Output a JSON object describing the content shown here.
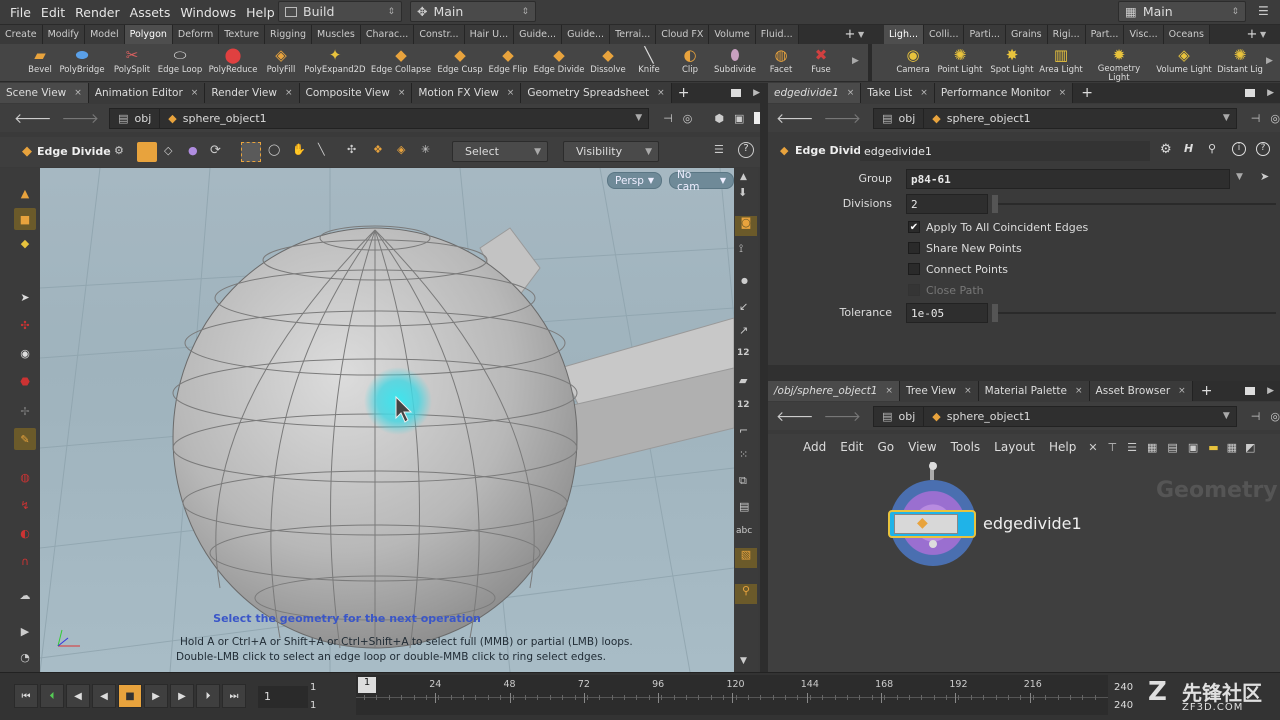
{
  "menubar": {
    "items": [
      "File",
      "Edit",
      "Render",
      "Assets",
      "Windows",
      "Help"
    ],
    "desktop_label": "Build",
    "context_label": "Main",
    "right_label": "Main"
  },
  "shelf_tabs_left": [
    "Create",
    "Modify",
    "Model",
    "Polygon",
    "Deform",
    "Texture",
    "Rigging",
    "Muscles",
    "Charac...",
    "Constr...",
    "Hair U...",
    "Guide...",
    "Guide...",
    "Terrai...",
    "Cloud FX",
    "Volume",
    "Fluid..."
  ],
  "shelf_tabs_right": [
    "Ligh...",
    "Colli...",
    "Parti...",
    "Grains",
    "Rigi...",
    "Part...",
    "Visc...",
    "Oceans"
  ],
  "shelf_tools_left": [
    "Bevel",
    "PolyBridge",
    "PolySplit",
    "Edge Loop",
    "PolyReduce",
    "PolyFill",
    "PolyExpand2D",
    "Edge Collapse",
    "Edge Cusp",
    "Edge Flip",
    "Edge Divide",
    "Dissolve",
    "Knife",
    "Clip",
    "Subdivide",
    "Facet",
    "Fuse"
  ],
  "shelf_tools_right": [
    "Camera",
    "Point Light",
    "Spot Light",
    "Area Light",
    "Geometry Light",
    "Volume Light",
    "Distant Lig"
  ],
  "left_pane": {
    "tabs": [
      "Scene View",
      "Animation Editor",
      "Render View",
      "Composite View",
      "Motion FX View",
      "Geometry Spreadsheet"
    ],
    "path": [
      "obj",
      "sphere_object1"
    ],
    "tool_name": "Edge Divide",
    "select_label": "Select",
    "visibility_label": "Visibility",
    "persp_label": "Persp",
    "cam_label": "No cam",
    "hint_title": "Select the geometry for the next operation",
    "hint_line1": "Hold A or Ctrl+A or Shift+A or Ctrl+Shift+A to select full (MMB) or partial (LMB) loops.",
    "hint_line2": "Double-LMB click to select an edge loop or double-MMB click to ring select edges.",
    "right_tool_labels": [
      "12",
      "12",
      "abc"
    ]
  },
  "params_pane": {
    "tabs": [
      "edgedivide1",
      "Take List",
      "Performance Monitor"
    ],
    "path": [
      "obj",
      "sphere_object1"
    ],
    "node_type": "Edge Divide",
    "node_name": "edgedivide1",
    "group_label": "Group",
    "group_value": "p84-61",
    "divisions_label": "Divisions",
    "divisions_value": "2",
    "checkboxes": [
      {
        "label": "Apply To All Coincident Edges",
        "checked": true
      },
      {
        "label": "Share New Points",
        "checked": false
      },
      {
        "label": "Connect Points",
        "checked": false
      },
      {
        "label": "Close Path",
        "checked": false,
        "disabled": true
      }
    ],
    "tolerance_label": "Tolerance",
    "tolerance_value": "1e-05"
  },
  "network_pane": {
    "tabs": [
      "/obj/sphere_object1",
      "Tree View",
      "Material Palette",
      "Asset Browser"
    ],
    "path": [
      "obj",
      "sphere_object1"
    ],
    "menu": [
      "Add",
      "Edit",
      "Go",
      "View",
      "Tools",
      "Layout",
      "Help"
    ],
    "context_label": "Geometry",
    "node_label": "edgedivide1"
  },
  "timeline": {
    "current_frame": "1",
    "start_frame": "1",
    "start_frame_2": "1",
    "cursor_label": "1",
    "ticks": [
      "24",
      "48",
      "72",
      "96",
      "120",
      "144",
      "168",
      "192",
      "216"
    ],
    "end_frame": "240",
    "end_frame_2": "240"
  },
  "watermark": {
    "text": "先锋社区",
    "sub": "ZF3D.COM"
  },
  "colors": {
    "accent": "#e8a33d",
    "node_cyan": "#1fb3e8",
    "node_purple": "#9a6fd0",
    "hint_blue": "#3a56c8"
  }
}
